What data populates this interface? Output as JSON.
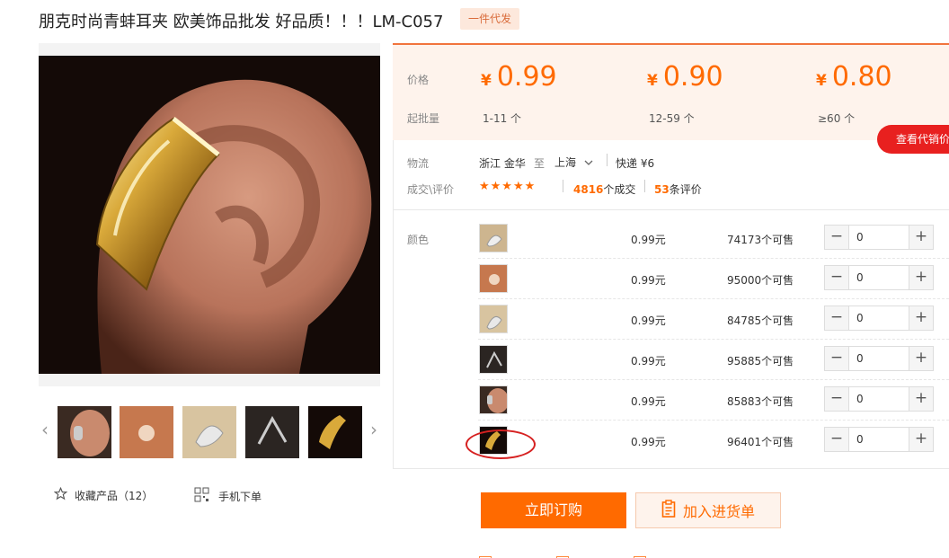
{
  "product": {
    "title": "朋克时尚青蚌耳夹 欧美饰品批发 好品质！！！LM-C057",
    "tag": "一件代发"
  },
  "pricing": {
    "price_label": "价格",
    "min_qty_label": "起批量",
    "tiers": [
      {
        "currency": "¥",
        "price": "0.99",
        "range": "1-11 个"
      },
      {
        "currency": "¥",
        "price": "0.90",
        "range": "12-59 个"
      },
      {
        "currency": "¥",
        "price": "0.80",
        "range": "≥60 个"
      }
    ],
    "agent_button": "查看代销价"
  },
  "logistics": {
    "label": "物流",
    "from": "浙江 金华",
    "to_word": "至",
    "to": "上海",
    "shipping": "快递 ¥6"
  },
  "deals": {
    "label": "成交\\评价",
    "stars": "★★★★★",
    "deals_count": "4816",
    "deals_suffix": "个成交",
    "reviews_count": "53",
    "reviews_suffix": "条评价"
  },
  "sku": {
    "label": "颜色",
    "rows": [
      {
        "price": "0.99元",
        "stock": "74173个可售",
        "qty": "0"
      },
      {
        "price": "0.99元",
        "stock": "95000个可售",
        "qty": "0"
      },
      {
        "price": "0.99元",
        "stock": "84785个可售",
        "qty": "0"
      },
      {
        "price": "0.99元",
        "stock": "95885个可售",
        "qty": "0"
      },
      {
        "price": "0.99元",
        "stock": "85883个可售",
        "qty": "0"
      },
      {
        "price": "0.99元",
        "stock": "96401个可售",
        "qty": "0"
      }
    ],
    "minus": "−",
    "plus": "+"
  },
  "actions": {
    "buy_now": "立即订购",
    "add_cart": "加入进货单",
    "favorite": "收藏产品（12）",
    "mobile_order": "手机下单"
  },
  "icons": {
    "star_outline": "star-outline-icon",
    "qr": "qr-code-icon",
    "clipboard": "clipboard-icon",
    "chevron_down": "chevron-down-icon"
  },
  "colors": {
    "accent": "#ff6a00",
    "agent_red": "#e8201f",
    "price_bg": "#fef3ec"
  }
}
